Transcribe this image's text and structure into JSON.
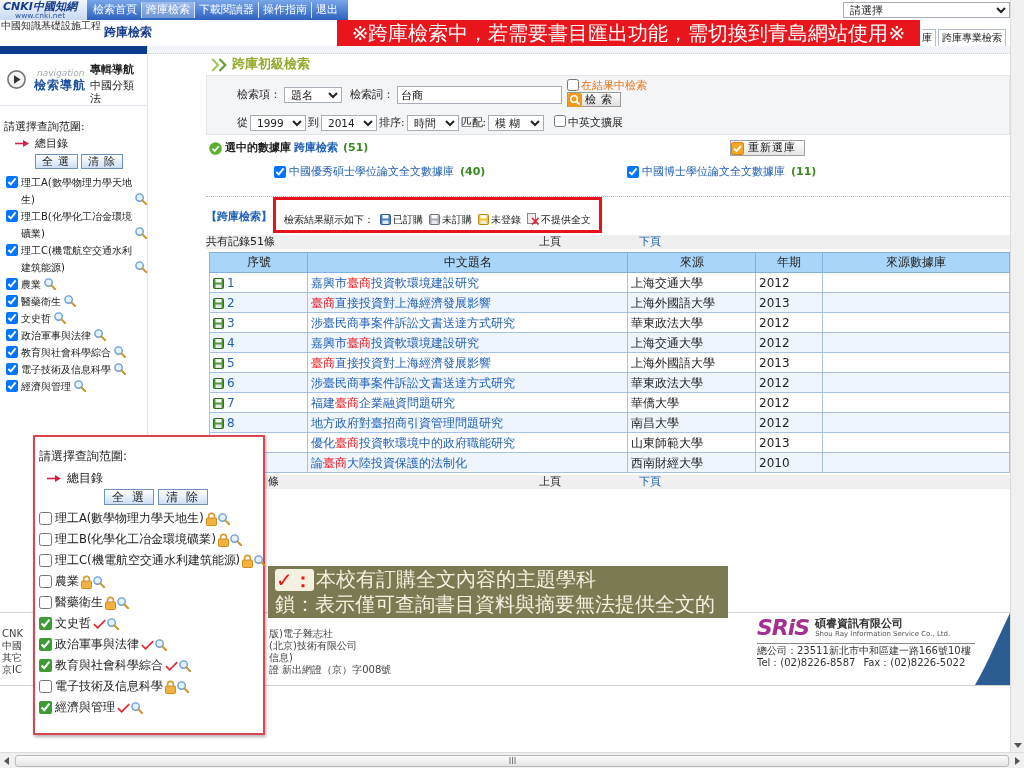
{
  "header": {
    "logo": {
      "wordmark": "CNKI中國知網",
      "url": "www.cnki.net",
      "subtitle": "中國知識基礎設施工程"
    },
    "nav_links": [
      {
        "label": "檢索首頁",
        "selected": false
      },
      {
        "label": "跨庫檢索",
        "selected": true
      },
      {
        "label": "下載閱讀器",
        "selected": false
      },
      {
        "label": "操作指南",
        "selected": false
      },
      {
        "label": "退出",
        "selected": false
      }
    ],
    "site_select": "請選擇",
    "page_title": "跨庫檢索",
    "tabs": [
      "庫",
      "跨庫專業檢索"
    ]
  },
  "notice_banner": "※跨庫檢索中，若需要書目匯出功能，需切換到青島網站使用※",
  "sidebar": {
    "nav_button": {
      "caption": "navigation",
      "label": "檢索導航"
    },
    "nav_links": [
      {
        "label": "專輯導航",
        "selected": true
      },
      {
        "label": "中國分類法",
        "selected": false
      }
    ],
    "scope_label": "請選擇查詢范圍:",
    "root": "總目錄",
    "buttons": [
      "全 選",
      "清 除"
    ],
    "categories": [
      {
        "label": "理工A(數學物理力學天地生)",
        "checked": true
      },
      {
        "label": "理工B(化學化工冶金環境礦業)",
        "checked": true
      },
      {
        "label": "理工C(機電航空交通水利建筑能源)",
        "checked": true
      },
      {
        "label": "農業",
        "checked": true
      },
      {
        "label": "醫藥衛生",
        "checked": true
      },
      {
        "label": "文史哲",
        "checked": true
      },
      {
        "label": "政治軍事與法律",
        "checked": true
      },
      {
        "label": "教育與社會科學綜合",
        "checked": true
      },
      {
        "label": "電子技術及信息科學",
        "checked": true
      },
      {
        "label": "經濟與管理",
        "checked": true
      }
    ]
  },
  "search": {
    "title": "跨庫初級檢索",
    "field_label": "檢索項：",
    "field": "題名",
    "term_label": "檢索詞：",
    "term": "台商",
    "within_results": {
      "label": "在結果中檢索",
      "checked": false
    },
    "search_button": "檢 索",
    "from_label": "從",
    "from": "1999",
    "to_label": "到",
    "to": "2014",
    "sort_label": "排序:",
    "sort": "時間",
    "match_label": "匹配:",
    "match": "模 糊",
    "expand": {
      "label": "中英文擴展",
      "checked": false
    }
  },
  "databases": {
    "label": "選中的數據庫",
    "link": "跨庫檢索",
    "count": "(51)",
    "reselect_button": "重新選庫",
    "items": [
      {
        "name": "中國優秀碩士學位論文全文數據庫",
        "count": "(40)",
        "checked": true
      },
      {
        "name": "中國博士學位論文全文數據庫",
        "count": "(11)",
        "checked": true
      }
    ]
  },
  "results": {
    "tag": "【跨庫檢索】",
    "legend_label": "檢索結果顯示如下：",
    "legend": [
      {
        "kind": "subscribed",
        "label": "已訂購"
      },
      {
        "kind": "unsubscribed",
        "label": "未訂購"
      },
      {
        "kind": "unregistered",
        "label": "未登錄"
      },
      {
        "kind": "no_fulltext",
        "label": "不提供全文"
      }
    ],
    "pager_top": {
      "total": "共有記錄51條",
      "prev": {
        "label": "上頁",
        "disabled": true
      },
      "next": {
        "label": "下頁",
        "disabled": false
      }
    },
    "columns": [
      "序號",
      "中文題名",
      "來源",
      "年期",
      "來源數據庫"
    ],
    "rows": [
      {
        "no": "1",
        "title": [
          {
            "text": "嘉興市",
            "highlight": false
          },
          {
            "text": "臺商",
            "highlight": true
          },
          {
            "text": "投資軟環境建設研究",
            "highlight": false
          }
        ],
        "source": "上海交通大學",
        "year": "2012"
      },
      {
        "no": "2",
        "title": [
          {
            "text": "臺商",
            "highlight": true
          },
          {
            "text": "直接投資對上海經濟發展影響",
            "highlight": false
          }
        ],
        "source": "上海外國語大學",
        "year": "2013"
      },
      {
        "no": "3",
        "title": [
          {
            "text": "涉臺民商事案件訴訟文書送達方式研究",
            "highlight": false
          }
        ],
        "source": "華東政法大學",
        "year": "2012"
      },
      {
        "no": "4",
        "title": [
          {
            "text": "嘉興市",
            "highlight": false
          },
          {
            "text": "臺商",
            "highlight": true
          },
          {
            "text": "投資軟環境建設研究",
            "highlight": false
          }
        ],
        "source": "上海交通大學",
        "year": "2012"
      },
      {
        "no": "5",
        "title": [
          {
            "text": "臺商",
            "highlight": true
          },
          {
            "text": "直接投資對上海經濟發展影響",
            "highlight": false
          }
        ],
        "source": "上海外國語大學",
        "year": "2013"
      },
      {
        "no": "6",
        "title": [
          {
            "text": "涉臺民商事案件訴訟文書送達方式研究",
            "highlight": false
          }
        ],
        "source": "華東政法大學",
        "year": "2012"
      },
      {
        "no": "7",
        "title": [
          {
            "text": "福建",
            "highlight": false
          },
          {
            "text": "臺商",
            "highlight": true
          },
          {
            "text": "企業融資問題研究",
            "highlight": false
          }
        ],
        "source": "華僑大學",
        "year": "2012"
      },
      {
        "no": "8",
        "title": [
          {
            "text": "地方政府對臺招商引資管理問題研究",
            "highlight": false
          }
        ],
        "source": "南昌大學",
        "year": "2012"
      },
      {
        "title": [
          {
            "text": "優化",
            "highlight": false
          },
          {
            "text": "臺商",
            "highlight": true
          },
          {
            "text": "投資軟環境中的政府職能研究",
            "highlight": false
          }
        ],
        "source": "山東師範大學",
        "year": "2013"
      },
      {
        "title": [
          {
            "text": "論",
            "highlight": false
          },
          {
            "text": "臺商",
            "highlight": true
          },
          {
            "text": "大陸投資保護的法制化",
            "highlight": false
          }
        ],
        "source": "西南財經大學",
        "year": "2010"
      }
    ],
    "pager_bottom": {
      "total": "條",
      "prev": {
        "label": "上頁",
        "disabled": true
      },
      "next": {
        "label": "下頁",
        "disabled": false
      }
    }
  },
  "footer": {
    "left_lines": [
      "CNK",
      "中國",
      "其它",
      "京IC"
    ],
    "right_lines": [
      "版)電子雜志社",
      "(北京)技術有限公司",
      "信息)",
      "證 新出網證（京）字008號"
    ],
    "company": {
      "logo": "SRiS",
      "name": "碩睿資訊有限公司",
      "english": "Shou Ray Information Service Co., Ltd.",
      "address": "總公司：23511新北市中和區建一路166號10樓",
      "phone": "Tel：(02)8226-8587",
      "fax": "Fax：(02)8226-5022"
    }
  },
  "scope_popup": {
    "title": "請選擇查詢范圍:",
    "root": "總目錄",
    "buttons": [
      "全 選",
      "清 除"
    ],
    "categories": [
      {
        "label": "理工A(數學物理力學天地生)",
        "checked": false,
        "subscribed": false
      },
      {
        "label": "理工B(化學化工冶金環境礦業)",
        "checked": false,
        "subscribed": false
      },
      {
        "label": "理工C(機電航空交通水利建筑能源)",
        "checked": false,
        "subscribed": false
      },
      {
        "label": "農業",
        "checked": false,
        "subscribed": false
      },
      {
        "label": "醫藥衛生",
        "checked": false,
        "subscribed": false
      },
      {
        "label": "文史哲",
        "checked": true,
        "subscribed": true
      },
      {
        "label": "政治軍事與法律",
        "checked": true,
        "subscribed": true
      },
      {
        "label": "教育與社會科學綜合",
        "checked": true,
        "subscribed": true
      },
      {
        "label": "電子技術及信息科學",
        "checked": false,
        "subscribed": false
      },
      {
        "label": "經濟與管理",
        "checked": true,
        "subscribed": true
      }
    ]
  },
  "annotation": {
    "lines": [
      {
        "marker": "✓：",
        "color": "#e8141c",
        "text": "本校有訂購全文內容的主題學科"
      },
      {
        "marker": "鎖：",
        "text": "表示僅可查詢書目資料與摘要無法提供全文的"
      }
    ]
  }
}
